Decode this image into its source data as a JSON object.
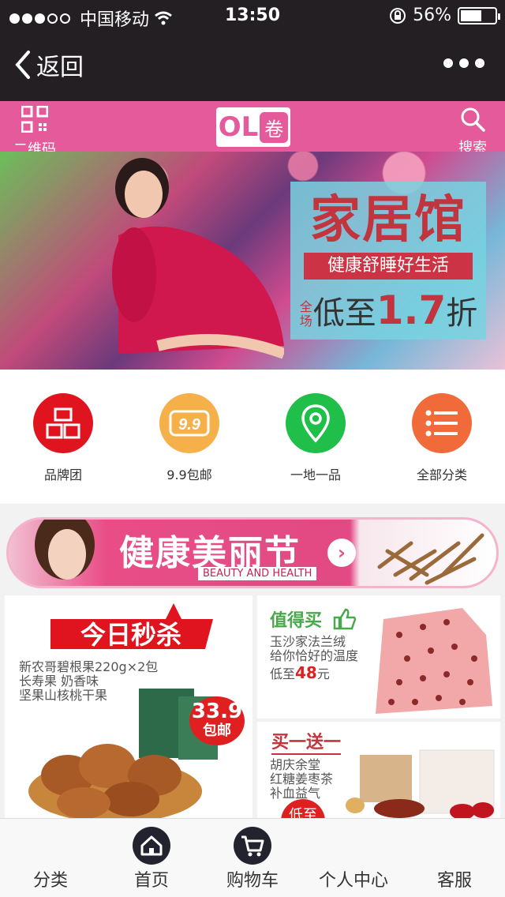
{
  "status_bar": {
    "carrier": "中国移动",
    "time": "13:50",
    "battery": "56%",
    "battery_fraction": 0.56
  },
  "nav": {
    "back_label": "返回"
  },
  "header": {
    "qr_label": "二维码",
    "logo_text": "OL",
    "logo_badge": "卷",
    "search_label": "搜索"
  },
  "hero": {
    "title": "家居馆",
    "ribbon": "健康舒睡好生活",
    "qualifier": "全场",
    "sale_prefix": "低至",
    "sale_num": "1.7",
    "sale_suffix": "折"
  },
  "categories": [
    {
      "label": "品牌团",
      "color": "#e0141e"
    },
    {
      "label": "9.9包邮",
      "color": "#f5b04a"
    },
    {
      "label": "一地一品",
      "color": "#1fbf4a"
    },
    {
      "label": "全部分类",
      "color": "#f06a3a"
    }
  ],
  "banner": {
    "title": "健康美丽节",
    "subtitle": "BEAUTY AND HEALTH"
  },
  "seckill": {
    "title": "今日秒杀",
    "desc1": "新农哥碧根果220g×2包",
    "desc2": "长寿果 奶香味",
    "desc3": "坚果山核桃干果",
    "price": "33.9",
    "price_tag": "包邮"
  },
  "worth_buy": {
    "title": "值得买",
    "desc1": "玉沙家法兰绒",
    "desc2": "给你恰好的温度",
    "price_prefix": "低至",
    "price": "48",
    "price_unit": "元"
  },
  "bogo": {
    "title": "买一送一",
    "desc1": "胡庆余堂",
    "desc2": "红糖姜枣茶",
    "desc3": "补血益气",
    "badge": "低至"
  },
  "tabbar": [
    {
      "label": "分类"
    },
    {
      "label": "首页"
    },
    {
      "label": "购物车"
    },
    {
      "label": "个人中心"
    },
    {
      "label": "客服"
    }
  ],
  "colors": {
    "nav_bg": "#231f22",
    "brand_pink": "#e55a9a",
    "promo_red": "#c0353e",
    "green_accent": "#4aa84c"
  }
}
